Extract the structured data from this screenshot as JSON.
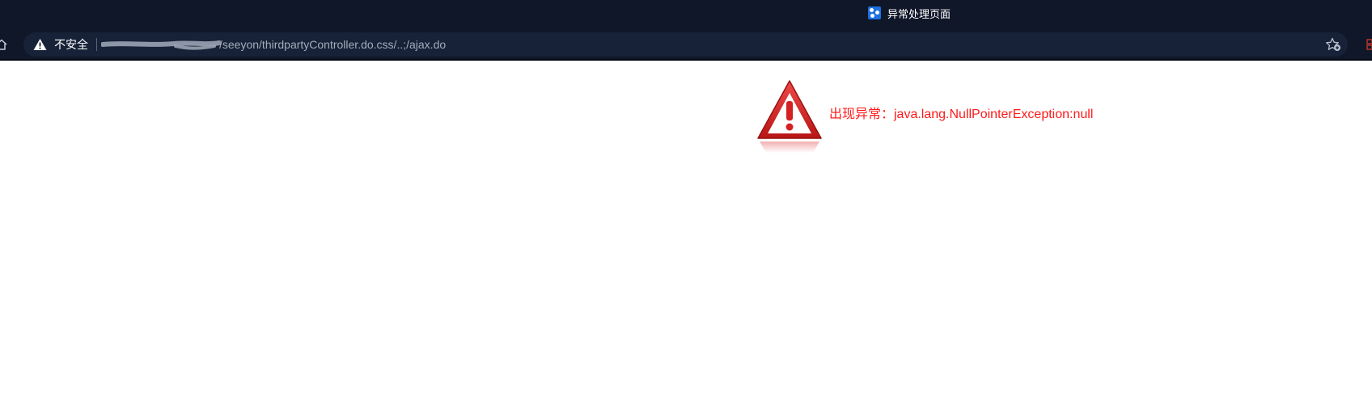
{
  "browser": {
    "tab": {
      "title": "异常处理页面",
      "favicon_icon": "app-favicon-icon"
    },
    "toolbar": {
      "home_icon": "home-icon",
      "security_icon": "warning-triangle-icon",
      "security_label": "不安全",
      "url_path": "/seeyon/thirdpartyController.do.css/..;/ajax.do",
      "bookmark_icon": "bookmark-star-add-icon",
      "extension_icon": "extensions-icon"
    }
  },
  "page": {
    "error_icon": "error-warning-triangle-icon",
    "error_message": "出现异常：java.lang.NullPointerException:null"
  },
  "colors": {
    "chrome_background": "#0f1729",
    "omnibox_background": "#172238",
    "url_text": "#a3acba",
    "error_text": "#ff1a1a",
    "favicon_accent": "#1e6fe0"
  }
}
